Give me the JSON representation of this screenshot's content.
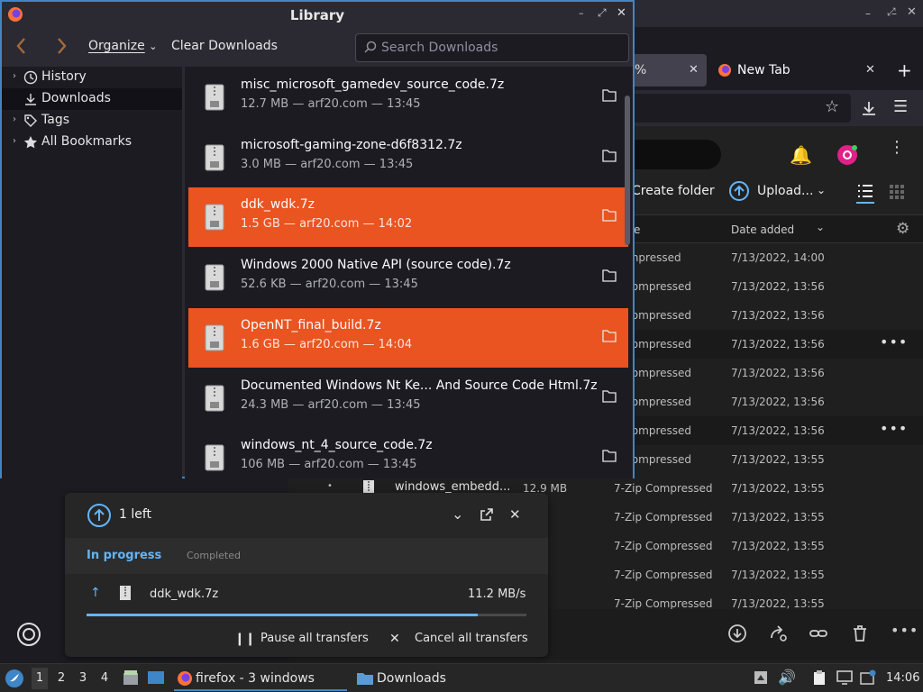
{
  "library": {
    "title": "Library",
    "toolbar": {
      "organize": "Organize",
      "clear": "Clear Downloads",
      "search_placeholder": "Search Downloads"
    },
    "sidebar": [
      {
        "label": "History",
        "icon": "clock-icon",
        "twisty": "›"
      },
      {
        "label": "Downloads",
        "icon": "download-icon",
        "twisty": ""
      },
      {
        "label": "Tags",
        "icon": "tag-icon",
        "twisty": "›"
      },
      {
        "label": "All Bookmarks",
        "icon": "star-icon",
        "twisty": "›"
      }
    ],
    "downloads": [
      {
        "name": "misc_microsoft_gamedev_source_code.7z",
        "meta": "12.7 MB — arf20.com — 13:45",
        "selected": false
      },
      {
        "name": "microsoft-gaming-zone-d6f8312.7z",
        "meta": "3.0 MB — arf20.com — 13:45",
        "selected": false
      },
      {
        "name": "ddk_wdk.7z",
        "meta": "1.5 GB — arf20.com — 14:02",
        "selected": true
      },
      {
        "name": "Windows 2000 Native API (source code).7z",
        "meta": "52.6 KB — arf20.com — 13:45",
        "selected": false
      },
      {
        "name": "OpenNT_final_build.7z",
        "meta": "1.6 GB — arf20.com — 14:04",
        "selected": true
      },
      {
        "name": "Documented Windows Nt Ke... And Source Code Html.7z",
        "meta": "24.3 MB — arf20.com — 13:45",
        "selected": false
      },
      {
        "name": "windows_nt_4_source_code.7z",
        "meta": "106 MB — arf20.com — 13:45",
        "selected": false
      }
    ]
  },
  "browser": {
    "tab1_label": "%",
    "tab2_label": "New Tab",
    "drive": {
      "create_folder": "Create folder",
      "upload": "Upload...",
      "col_type": "e",
      "col_date": "Date added",
      "rows": [
        {
          "name": "",
          "size": "",
          "type": "Compressed",
          "date": "7/13/2022, 14:00",
          "more": false
        },
        {
          "name": "",
          "size": "",
          "type": "p Compressed",
          "date": "7/13/2022, 13:56",
          "more": false
        },
        {
          "name": "",
          "size": "",
          "type": "p Compressed",
          "date": "7/13/2022, 13:56",
          "more": false
        },
        {
          "name": "",
          "size": "",
          "type": "p Compressed",
          "date": "7/13/2022, 13:56",
          "more": true
        },
        {
          "name": "",
          "size": "",
          "type": "p Compressed",
          "date": "7/13/2022, 13:56",
          "more": false
        },
        {
          "name": "",
          "size": "",
          "type": "p Compressed",
          "date": "7/13/2022, 13:56",
          "more": false
        },
        {
          "name": "",
          "size": "",
          "type": "p Compressed",
          "date": "7/13/2022, 13:56",
          "more": true
        },
        {
          "name": "",
          "size": "",
          "type": "p Compressed",
          "date": "7/13/2022, 13:55",
          "more": false
        },
        {
          "name": "windows_embedd...",
          "size": "12.9 MB",
          "type": "7-Zip Compressed",
          "date": "7/13/2022, 13:55",
          "more": false
        },
        {
          "name": "",
          "size": "MB",
          "type": "7-Zip Compressed",
          "date": "7/13/2022, 13:55",
          "more": false
        },
        {
          "name": "",
          "size": "B",
          "type": "7-Zip Compressed",
          "date": "7/13/2022, 13:55",
          "more": false
        },
        {
          "name": "",
          "size": "MB",
          "type": "7-Zip Compressed",
          "date": "7/13/2022, 13:55",
          "more": false
        },
        {
          "name": "",
          "size": "MB",
          "type": "7-Zip Compressed",
          "date": "7/13/2022, 13:55",
          "more": false
        }
      ]
    }
  },
  "transfer": {
    "count_label": "1 left",
    "tab_progress": "In progress",
    "tab_completed": "Completed",
    "file": "ddk_wdk.7z",
    "speed": "11.2 MB/s",
    "progress": 0.89,
    "pause": "Pause all transfers",
    "cancel": "Cancel all transfers"
  },
  "taskbar": {
    "workspaces": [
      "1",
      "2",
      "3",
      "4"
    ],
    "firefox": "firefox - 3 windows",
    "files": "Downloads",
    "clock": "14:06"
  },
  "colors": {
    "accent": "#e95420",
    "focus": "#3f86c8",
    "progress": "#64b5f6"
  }
}
